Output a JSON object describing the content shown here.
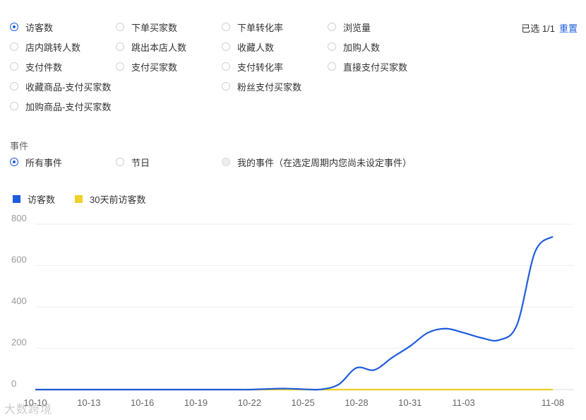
{
  "metrics": [
    {
      "label": "访客数",
      "checked": true
    },
    {
      "label": "下单买家数"
    },
    {
      "label": "下单转化率"
    },
    {
      "label": "浏览量"
    },
    {
      "label": "店内跳转人数"
    },
    {
      "label": "跳出本店人数"
    },
    {
      "label": "收藏人数"
    },
    {
      "label": "加购人数"
    },
    {
      "label": "支付件数"
    },
    {
      "label": "支付买家数"
    },
    {
      "label": "支付转化率"
    },
    {
      "label": "直接支付买家数"
    },
    {
      "label": "收藏商品-支付买家数"
    },
    {
      "label": "粉丝支付买家数"
    },
    {
      "label": "加购商品-支付买家数"
    }
  ],
  "selection": {
    "text": "已选 1/1",
    "reset": "重置"
  },
  "events": {
    "title": "事件",
    "options": [
      {
        "label": "所有事件",
        "checked": true
      },
      {
        "label": "节日"
      },
      {
        "label": "我的事件（在选定周期内您尚未设定事件）",
        "disabled": true
      }
    ]
  },
  "watermark": "大数跨境",
  "chart_data": {
    "type": "line",
    "x": [
      "10-10",
      "10-11",
      "10-12",
      "10-13",
      "10-14",
      "10-15",
      "10-16",
      "10-17",
      "10-18",
      "10-19",
      "10-20",
      "10-21",
      "10-22",
      "10-23",
      "10-24",
      "10-25",
      "10-26",
      "10-27",
      "10-28",
      "10-29",
      "10-30",
      "10-31",
      "11-01",
      "11-02",
      "11-03",
      "11-04",
      "11-05",
      "11-06",
      "11-07",
      "11-08"
    ],
    "xticks": [
      "10-10",
      "10-13",
      "10-16",
      "10-19",
      "10-22",
      "10-25",
      "10-28",
      "10-31",
      "11-03",
      "11-08"
    ],
    "ylim": [
      0,
      800
    ],
    "yticks": [
      0,
      200,
      400,
      600,
      800
    ],
    "series": [
      {
        "name": "访客数",
        "color": "#1f5cdc",
        "values": [
          0,
          0,
          0,
          0,
          0,
          0,
          0,
          0,
          0,
          0,
          0,
          0,
          0,
          3,
          5,
          2,
          1,
          25,
          105,
          95,
          155,
          210,
          275,
          295,
          275,
          250,
          240,
          315,
          665,
          740
        ]
      },
      {
        "name": "30天前访客数",
        "color": "#f0d028",
        "values": [
          0,
          0,
          0,
          0,
          0,
          0,
          0,
          0,
          0,
          0,
          0,
          0,
          0,
          0,
          0,
          0,
          0,
          0,
          0,
          0,
          0,
          0,
          0,
          0,
          0,
          0,
          0,
          0,
          0,
          0
        ]
      }
    ]
  }
}
